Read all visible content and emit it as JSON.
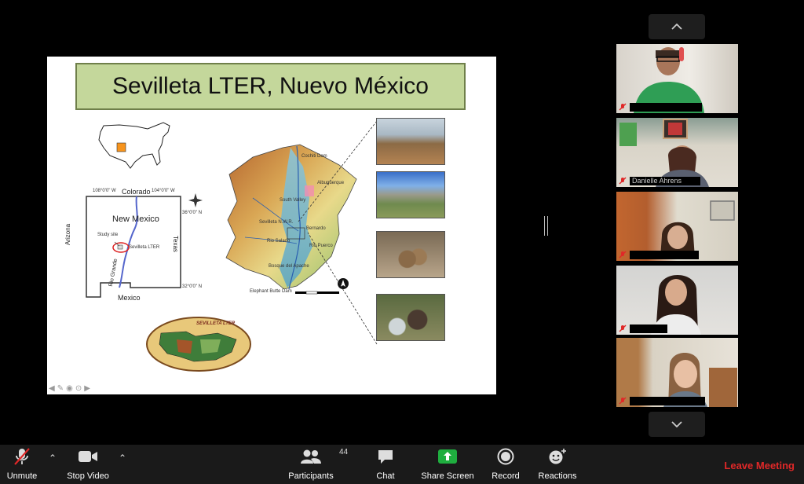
{
  "slide": {
    "title": "Sevilleta LTER, Nuevo México",
    "map": {
      "state_label": "New Mexico",
      "north_label": "Colorado",
      "south_label": "Mexico",
      "west_label": "Arizona",
      "east_label": "Texas",
      "river_label": "Rio Grande",
      "study_site_label": "Study site",
      "lter_label": "Sevilleta LTER",
      "lon_west": "108°0'0\" W",
      "lon_east": "104°0'0\" W",
      "lat_north": "36°0'0\" N",
      "lat_south": "32°0'0\" N"
    },
    "watershed_labels": [
      "Cochiti Dam",
      "Albuquerque",
      "South Valley",
      "Sevilleta N.W.R.",
      "Bernardo",
      "Rio Salado",
      "Rio Puerco",
      "Bosque del Apache",
      "Elephant Butte Dam"
    ],
    "logo_text": "SEVILLETA LTER"
  },
  "gallery": {
    "participants": [
      {
        "muted": true
      },
      {
        "muted": true,
        "name": "Danielle Ahrens"
      },
      {
        "muted": true
      },
      {
        "muted": true
      },
      {
        "muted": true
      }
    ]
  },
  "toolbar": {
    "unmute": "Unmute",
    "stop_video": "Stop Video",
    "participants": "Participants",
    "participants_count": "44",
    "chat": "Chat",
    "share_screen": "Share Screen",
    "record": "Record",
    "reactions": "Reactions",
    "leave": "Leave Meeting"
  },
  "colors": {
    "leave": "#e02828",
    "share_screen_green": "#1fae3f",
    "title_box": "#c4d79b"
  }
}
